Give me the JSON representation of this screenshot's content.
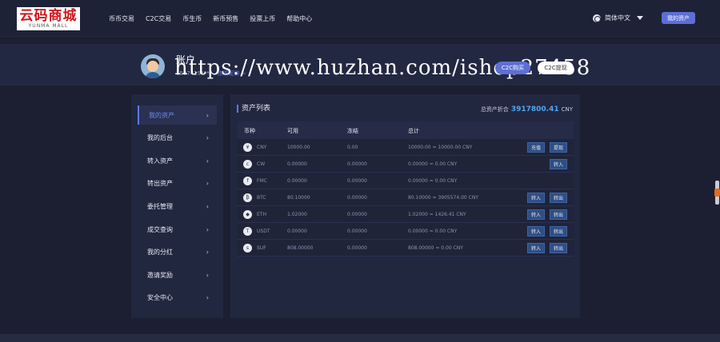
{
  "header": {
    "logo_text": "云码商城",
    "logo_sub": "YUNMA MALL",
    "nav": [
      "币币交易",
      "C2C交易",
      "币生币",
      "新币预售",
      "投票上币",
      "帮助中心"
    ],
    "language": "简体中文",
    "my_assets_button": "我的资产"
  },
  "account": {
    "title": "账户",
    "subtitle": "1507419****",
    "link": "修改昵称 >",
    "watermark": "https://www.huzhan.com/ishop27458",
    "c2c_buy": "C2C购买",
    "c2c_withdraw": "C2C提现"
  },
  "sidebar": {
    "items": [
      "我的资产",
      "我的后台",
      "转入资产",
      "转出资产",
      "委托管理",
      "成交查询",
      "我的分红",
      "邀请奖励",
      "安全中心"
    ]
  },
  "assets": {
    "title": "资产列表",
    "total_label": "总资产折合",
    "total_value": "3917800.41",
    "total_unit": "CNY",
    "columns": [
      "币种",
      "可用",
      "冻结",
      "总计"
    ],
    "rows": [
      {
        "coin": "CNY",
        "icon": "¥",
        "available": "10000.00",
        "frozen": "0.00",
        "total": "10000.00 ≈ 10000.00 CNY",
        "actions": [
          "充值",
          "提现"
        ]
      },
      {
        "coin": "CW",
        "icon": "c",
        "available": "0.00000",
        "frozen": "0.00000",
        "total": "0.00000 ≈ 0.00 CNY",
        "actions": [
          "转入"
        ]
      },
      {
        "coin": "FMC",
        "icon": "f",
        "available": "0.00000",
        "frozen": "0.00000",
        "total": "0.00000 ≈ 0.00 CNY",
        "actions": []
      },
      {
        "coin": "BTC",
        "icon": "₿",
        "available": "80.10000",
        "frozen": "0.00000",
        "total": "80.10000 ≈ 3905574.00 CNY",
        "actions": [
          "转入",
          "转出"
        ]
      },
      {
        "coin": "ETH",
        "icon": "◆",
        "available": "1.02000",
        "frozen": "0.00000",
        "total": "1.02000 ≈ 1426.41 CNY",
        "actions": [
          "转入",
          "转出"
        ]
      },
      {
        "coin": "USDT",
        "icon": "T",
        "available": "0.00000",
        "frozen": "0.00000",
        "total": "0.00000 ≈ 0.00 CNY",
        "actions": [
          "转入",
          "转出"
        ]
      },
      {
        "coin": "SUF",
        "icon": "s",
        "available": "808.00000",
        "frozen": "0.00000",
        "total": "808.00000 ≈ 0.00 CNY",
        "actions": [
          "转入",
          "转出"
        ]
      }
    ]
  },
  "colors": {
    "accent": "#5d6fd6",
    "link": "#5d79e8",
    "total": "#4fa6f5",
    "background": "#1b1f31"
  }
}
